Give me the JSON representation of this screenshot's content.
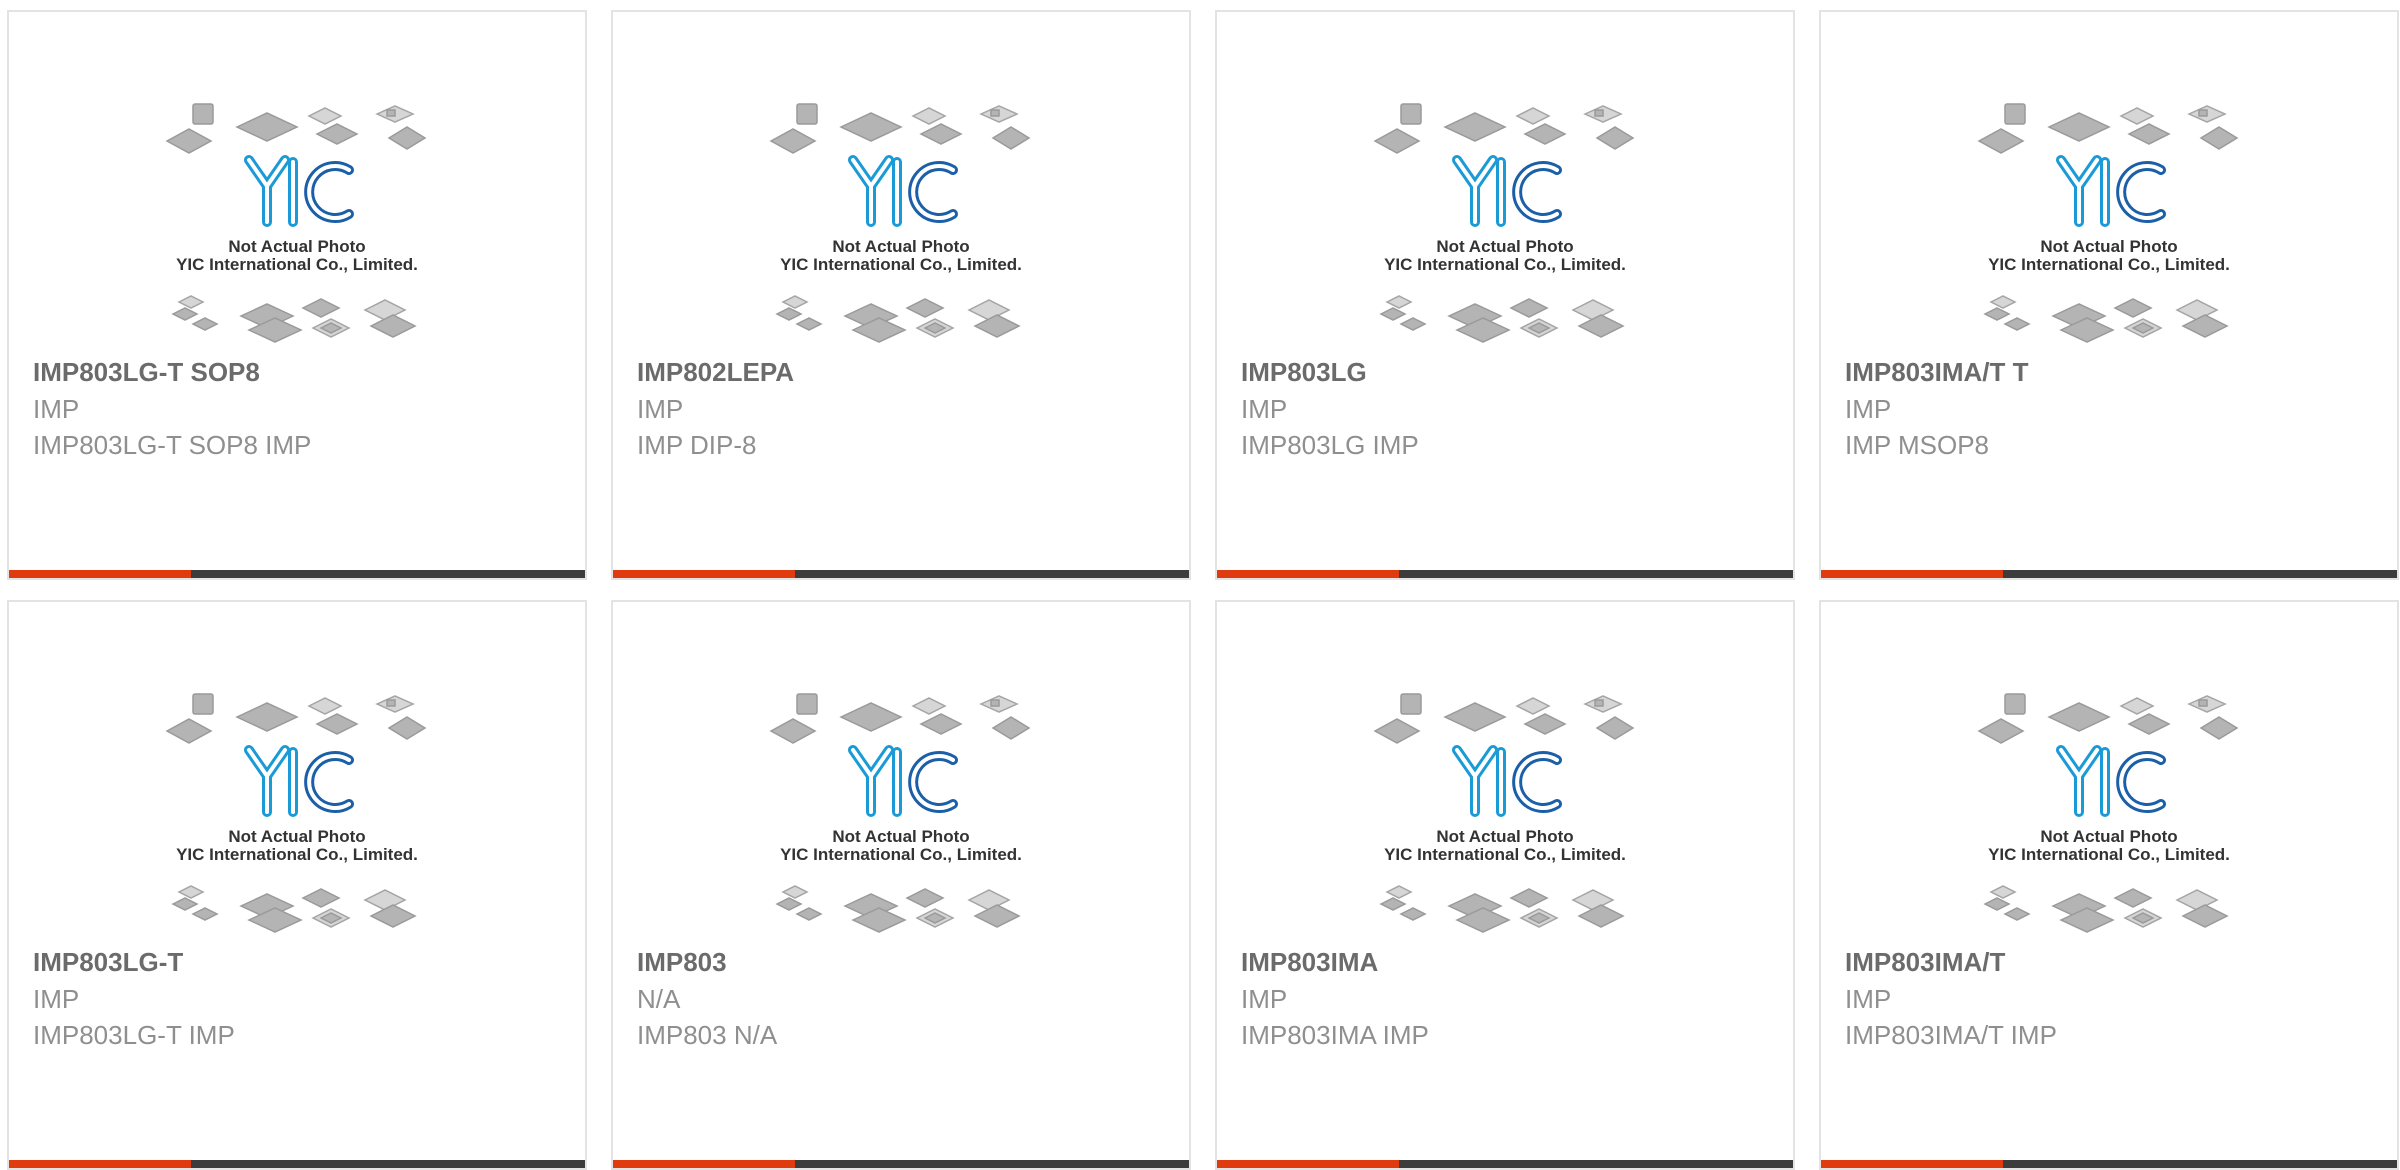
{
  "accent_color": "#e03a0f",
  "bar_color": "#3c3c3c",
  "placeholder": {
    "logo_text": "YIC",
    "caption_line1": "Not Actual Photo",
    "caption_line2": "YIC International Co., Limited."
  },
  "products": [
    {
      "title": "IMP803LG-T SOP8",
      "brand": "IMP",
      "desc": "IMP803LG-T SOP8 IMP"
    },
    {
      "title": "IMP802LEPA",
      "brand": "IMP",
      "desc": "IMP DIP-8"
    },
    {
      "title": "IMP803LG",
      "brand": "IMP",
      "desc": "IMP803LG IMP"
    },
    {
      "title": "IMP803IMA/T T",
      "brand": "IMP",
      "desc": "IMP MSOP8"
    },
    {
      "title": "IMP803LG-T",
      "brand": "IMP",
      "desc": "IMP803LG-T IMP"
    },
    {
      "title": "IMP803",
      "brand": "N/A",
      "desc": "IMP803 N/A"
    },
    {
      "title": "IMP803IMA",
      "brand": "IMP",
      "desc": "IMP803IMA IMP"
    },
    {
      "title": "IMP803IMA/T",
      "brand": "IMP",
      "desc": "IMP803IMA/T IMP"
    }
  ]
}
